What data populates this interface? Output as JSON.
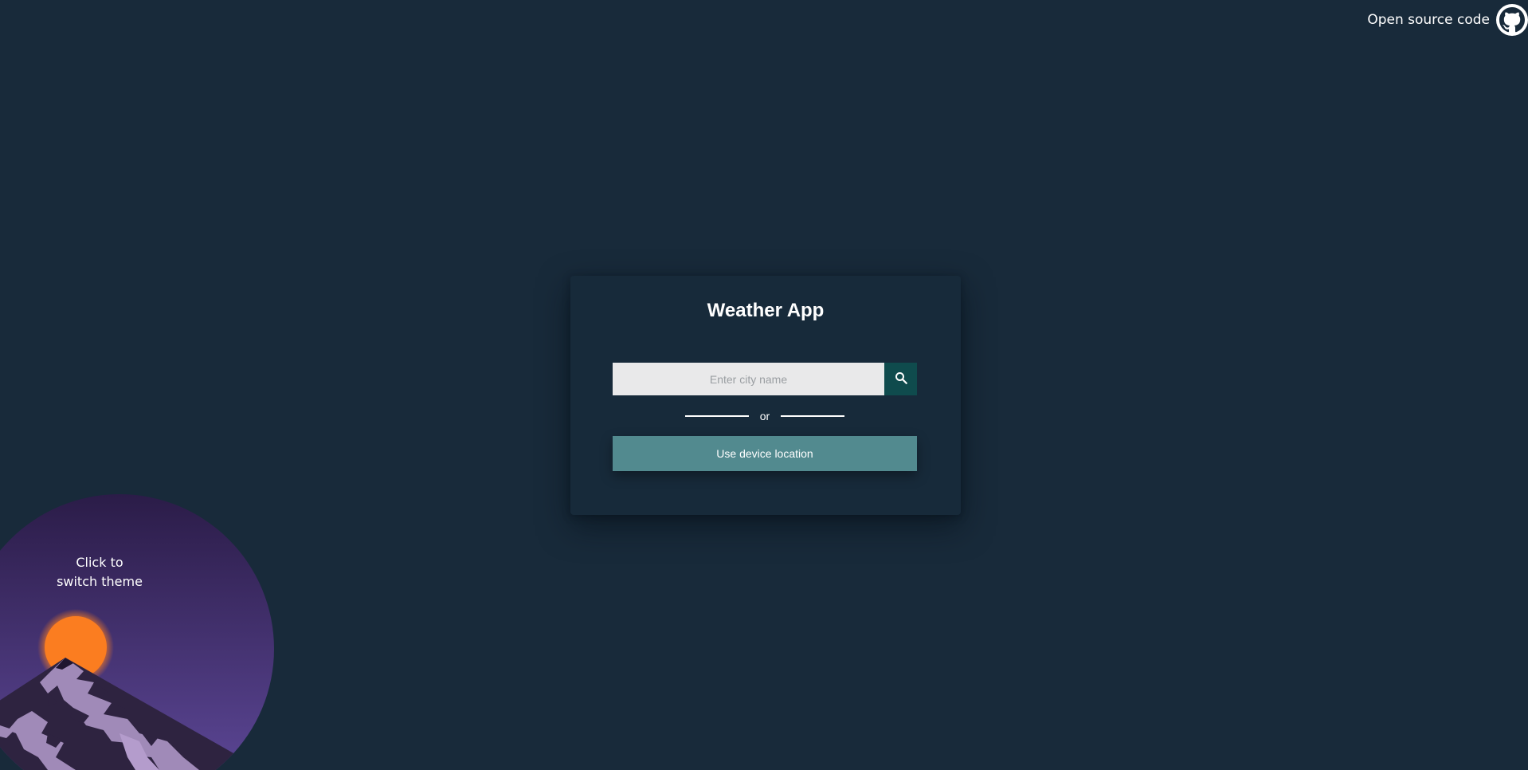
{
  "header": {
    "source_link_label": "Open source code",
    "source_link_icon": "github-icon"
  },
  "card": {
    "title": "Weather App",
    "search": {
      "placeholder": "Enter city name",
      "value": "",
      "button_icon": "search-icon"
    },
    "divider_text": "or",
    "location_button_label": "Use device location"
  },
  "theme_switch": {
    "line1": "Click to",
    "line2": "switch theme",
    "illustration": "sunset-mountain-icon"
  },
  "colors": {
    "background": "#182a3a",
    "card": "#172a3a",
    "input": "#e9e9ea",
    "search_button": "#0f4b4d",
    "location_button": "#528a8f",
    "sun": "#fb7d20",
    "sky_top": "#2b1c48",
    "sky_bottom": "#5a4593"
  }
}
